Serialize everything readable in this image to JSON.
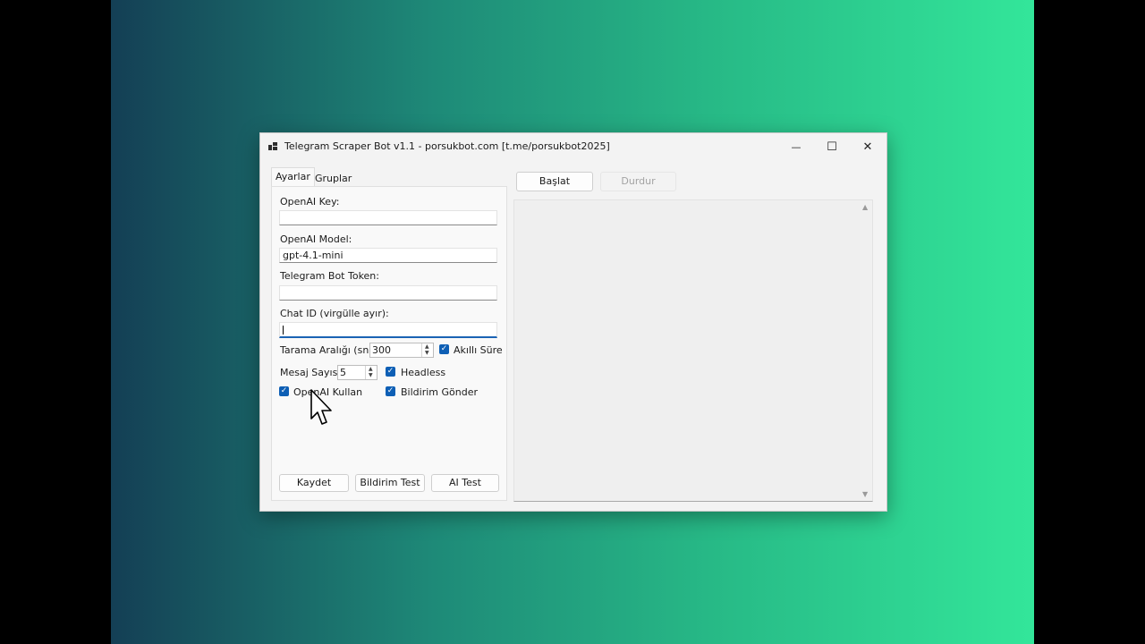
{
  "window": {
    "title": "Telegram Scraper Bot v1.1 - porsukbot.com [t.me/porsukbot2025]",
    "controls": {
      "minimize": "—",
      "maximize": "☐",
      "close": "✕"
    }
  },
  "tabs": [
    {
      "label": "Ayarlar",
      "active": true
    },
    {
      "label": "Gruplar",
      "active": false
    }
  ],
  "settings": {
    "openai_key": {
      "label": "OpenAI Key:",
      "value": ""
    },
    "openai_model": {
      "label": "OpenAI Model:",
      "value": "gpt-4.1-mini"
    },
    "bot_token": {
      "label": "Telegram Bot Token:",
      "value": ""
    },
    "chat_id": {
      "label": "Chat ID (virgülle ayır):",
      "value": ""
    },
    "scan_interval": {
      "label": "Tarama Aralığı (sn):",
      "value": "300"
    },
    "smart_time": {
      "label": "Akıllı Süre",
      "checked": true
    },
    "message_count": {
      "label": "Mesaj Sayısı:",
      "value": "5"
    },
    "headless": {
      "label": "Headless",
      "checked": true
    },
    "use_openai": {
      "label": "OpenAI Kullan",
      "checked": true
    },
    "send_notification": {
      "label": "Bildirim Gönder",
      "checked": true
    }
  },
  "buttons": {
    "save": "Kaydet",
    "notification_test": "Bildirim Test",
    "ai_test": "AI Test",
    "start": "Başlat",
    "stop": "Durdur"
  },
  "icons": {
    "check": "✓",
    "spin_up": "▲",
    "spin_down": "▼"
  },
  "colors": {
    "accent": "#0e5fb5",
    "window_bg": "#f3f3f3",
    "disabled_text": "#a3a3a3"
  }
}
